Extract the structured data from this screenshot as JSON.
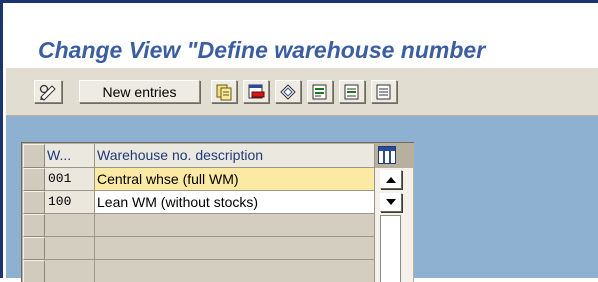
{
  "window": {
    "title": "Change View \"Define warehouse number"
  },
  "toolbar": {
    "new_entries_label": "New entries",
    "icons": [
      "change-display-icon",
      "copy-icon",
      "delete-icon",
      "undo-icon",
      "select-all-icon",
      "select-block-icon",
      "deselect-all-icon"
    ]
  },
  "table": {
    "columns": [
      "W...",
      "Warehouse no. description"
    ],
    "rows": [
      {
        "key": "001",
        "description": "Central whse (full WM)"
      },
      {
        "key": "100",
        "description": "Lean WM (without stocks)"
      }
    ]
  },
  "colors": {
    "title": "#3b5ea3",
    "selected_row": "#fce9a4",
    "content_background": "#8eb0d1",
    "window_border": "#1c3470"
  }
}
